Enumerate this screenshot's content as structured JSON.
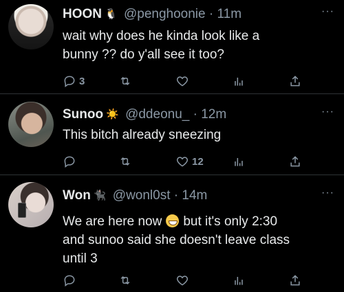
{
  "tweets": [
    {
      "name": "HOON",
      "emoji": "🐧",
      "handle": "@penghoonie",
      "dot": "·",
      "time": "11m",
      "text_lines": [
        "wait why does he kinda look like a",
        "bunny ?? do y'all see it too?"
      ],
      "reply_count": "3",
      "like_count": ""
    },
    {
      "name": "Sunoo",
      "emoji": "☀️",
      "handle": "@ddeonu_",
      "dot": "·",
      "time": "12m",
      "text_lines": [
        "This bitch already sneezing"
      ],
      "reply_count": "",
      "like_count": "12"
    },
    {
      "name": "Won",
      "emoji": "🐈‍⬛",
      "handle": "@wonl0st",
      "dot": "·",
      "time": "14m",
      "text_pre": "We are here now",
      "text_post": "but it's only 2:30",
      "text_lines": [
        "and sunoo said she doesn't leave class",
        "until 3"
      ],
      "reply_count": "",
      "like_count": ""
    }
  ],
  "more_label": "···",
  "icons": {
    "reply": "reply-icon",
    "retweet": "retweet-icon",
    "like": "like-icon",
    "analytics": "analytics-icon",
    "share": "share-icon",
    "emoji_inline": "grinning-face-emoji"
  },
  "colors": {
    "background": "#000000",
    "text": "#e7e9ea",
    "secondary": "#8b98a5",
    "divider": "#2f3336"
  }
}
